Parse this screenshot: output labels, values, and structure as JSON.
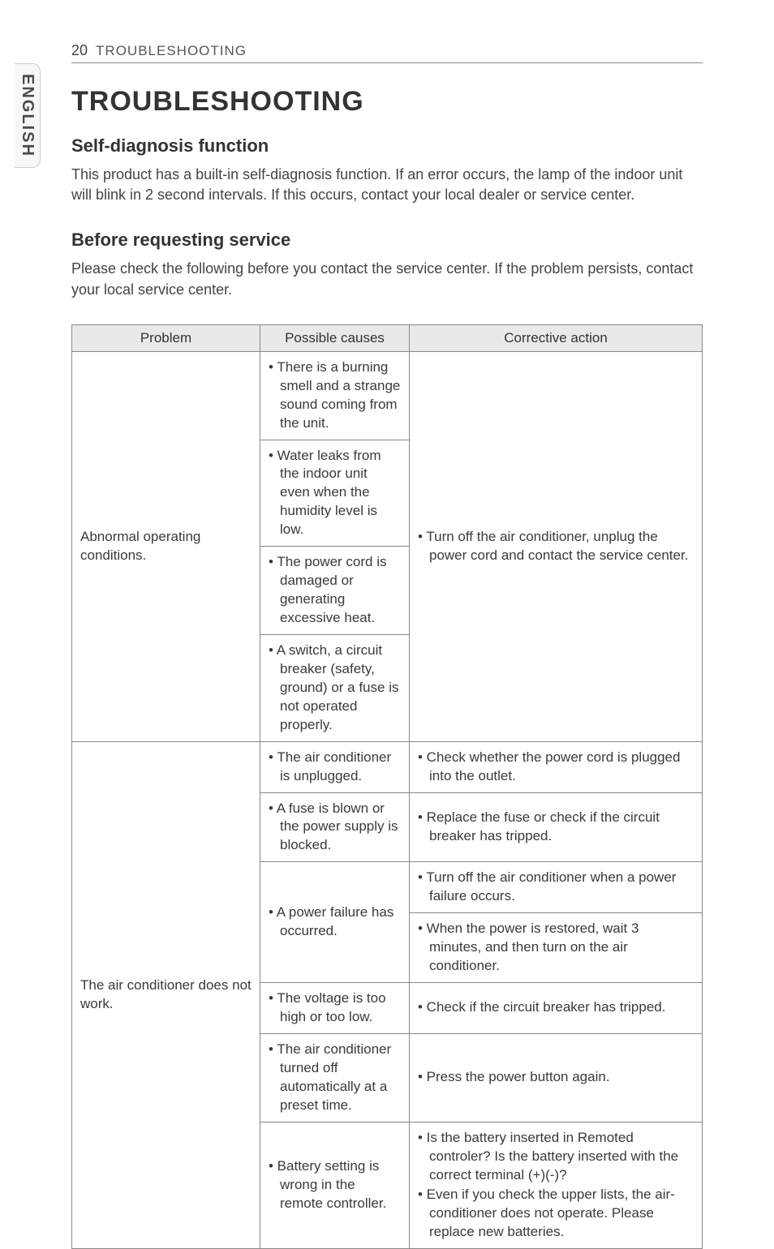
{
  "lang_tab": "ENGLISH",
  "header": {
    "page_number": "20",
    "section_label": "TROUBLESHOOTING"
  },
  "title": "TROUBLESHOOTING",
  "sections": {
    "self_diag": {
      "heading": "Self-diagnosis function",
      "text": "This product has a built-in self-diagnosis function. If an error occurs, the lamp of the indoor unit will blink in 2 second intervals. If this occurs, contact your local dealer or service center."
    },
    "before_service": {
      "heading": "Before requesting service",
      "text": "Please check the following before you contact the service center. If the problem persists, contact your local service center."
    }
  },
  "table": {
    "headers": {
      "problem": "Problem",
      "causes": "Possible causes",
      "action": "Corrective action"
    },
    "row1": {
      "problem": "Abnormal operating conditions.",
      "causes": [
        "• There is a burning smell and a strange sound coming from the unit.",
        "• Water leaks from the indoor unit even when the humidity level is low.",
        "• The power cord is damaged or generating excessive heat.",
        "• A switch, a circuit breaker (safety, ground) or a fuse is not operated properly."
      ],
      "action": "• Turn off the air conditioner, unplug the power cord and contact the service center."
    },
    "row2": {
      "problem": "The air conditioner does not work.",
      "sub": [
        {
          "cause": "• The air conditioner is unplugged.",
          "action": "• Check whether the power cord is plugged into the outlet."
        },
        {
          "cause": "• A fuse is blown or the power supply is blocked.",
          "action": "• Replace the fuse or check if the circuit breaker has tripped."
        },
        {
          "cause": "• A power failure has occurred.",
          "action1": "• Turn off the air conditioner when a power failure occurs.",
          "action2": "• When the power is restored, wait 3 minutes, and then turn on the air conditioner."
        },
        {
          "cause": "• The voltage is too high or too low.",
          "action": "• Check if the circuit breaker has tripped."
        },
        {
          "cause": "• The air conditioner turned off automatically at a preset time.",
          "action": "• Press the power button again."
        },
        {
          "cause": "• Battery setting is wrong in the remote controller.",
          "action1": "• Is the battery inserted in Remoted controler? Is the battery inserted with the correct terminal (+)(-)?",
          "action2": "• Even if you check the upper lists, the air-conditioner does not operate. Please replace new batteries."
        }
      ]
    }
  }
}
